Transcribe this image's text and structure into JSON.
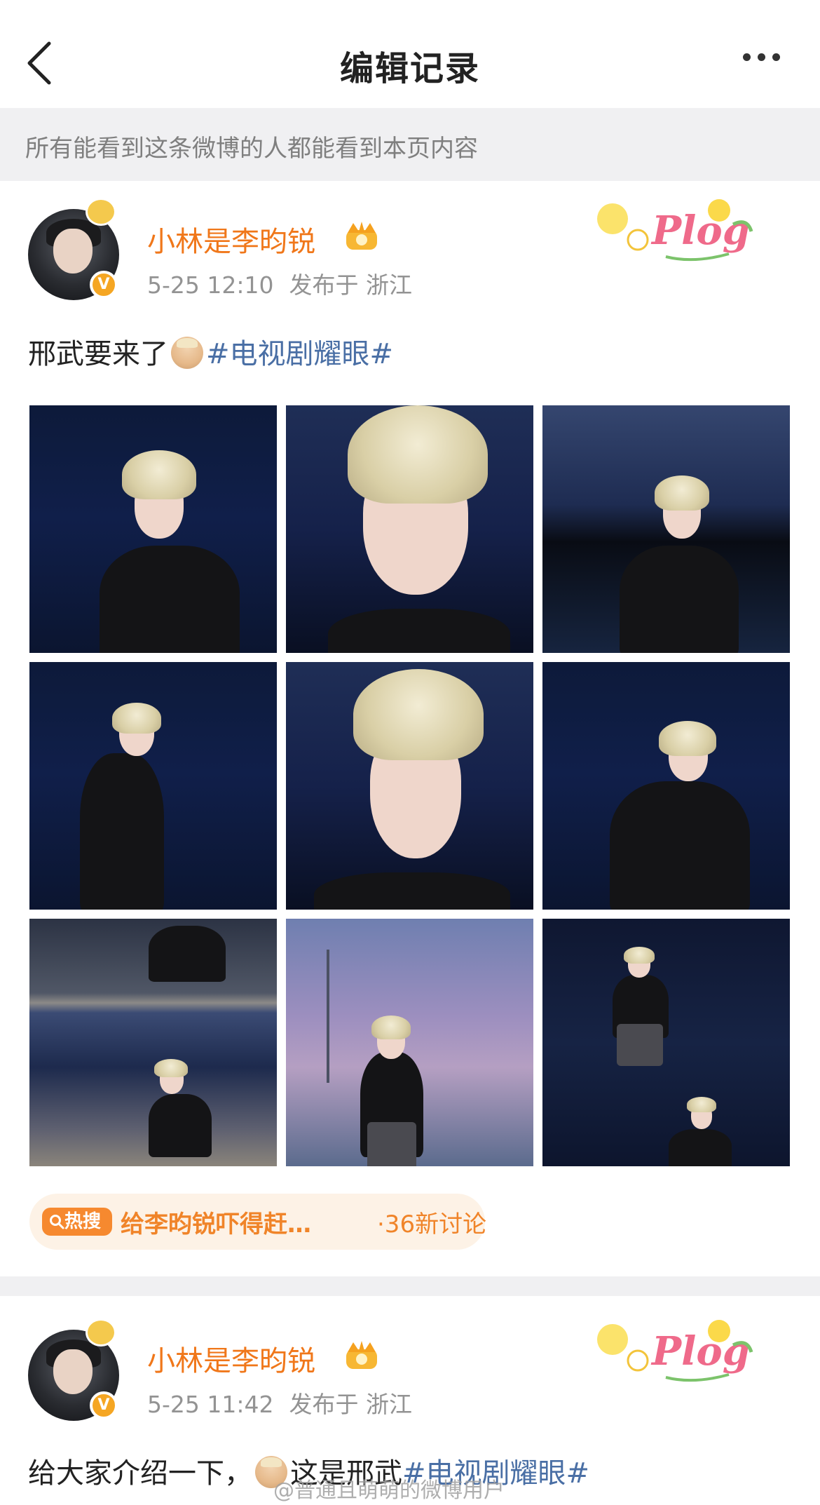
{
  "nav": {
    "title": "编辑记录",
    "back_icon": "chevron-left-icon",
    "more_icon": "more-dots-icon"
  },
  "notice": "所有能看到这条微博的人都能看到本页内容",
  "posts": [
    {
      "username": "小林是李昀锐",
      "time": "5-25 12:10",
      "location": "发布于 浙江",
      "text_before": "邢武要来了",
      "hashtag": "#电视剧耀眼#",
      "image_count": 9,
      "hot_search": {
        "badge": "热搜",
        "label": "给李昀锐吓得赶…",
        "count": "·36新讨论"
      }
    },
    {
      "username": "小林是李昀锐",
      "time": "5-25 11:42",
      "location": "发布于 浙江",
      "text_before": "给大家介绍一下，",
      "text_middle": "这是邢武",
      "hashtag": "#电视剧耀眼#"
    }
  ],
  "watermark": "@普通且萌萌的微博用户",
  "colors": {
    "username": "#f0771a",
    "hashtag": "#4a6fa5",
    "hot_badge": "#f6892f",
    "hot_text": "#f08429",
    "notice_bg": "#f0f0f2"
  }
}
